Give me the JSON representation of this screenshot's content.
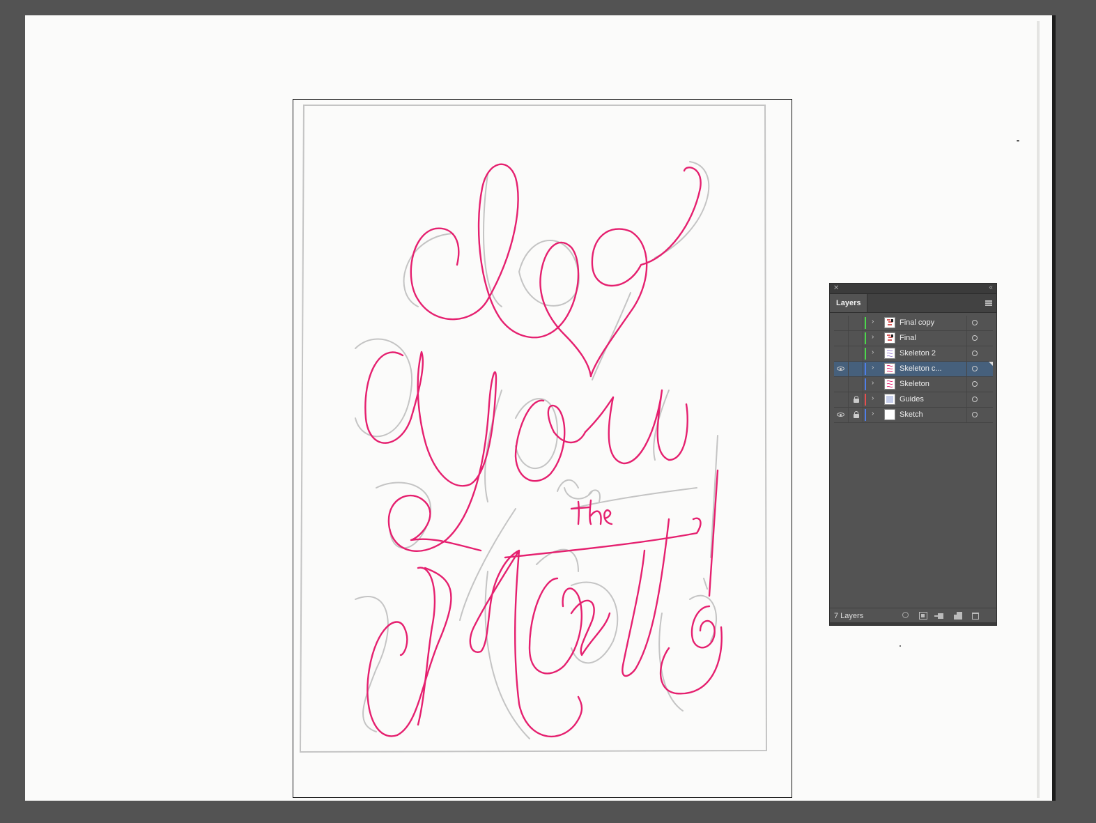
{
  "layers_panel": {
    "tab_title": "Layers",
    "layer_count_label": "7 Layers",
    "icons": {
      "close": "close-icon",
      "collapse": "collapse-icon",
      "menu": "panel-menu-icon",
      "visibility": "eye-icon",
      "lock": "lock-icon",
      "expand": "chevron-right-icon",
      "target": "target-circle-icon",
      "find": "find-icon",
      "clipping_mask": "clipping-mask-icon",
      "new_sublayer": "new-sublayer-icon",
      "new_layer": "new-layer-icon",
      "delete": "trash-icon"
    },
    "layers": [
      {
        "name": "Final copy",
        "color": "#4cd84c",
        "visible": false,
        "locked": false,
        "selected": false
      },
      {
        "name": "Final",
        "color": "#4cd84c",
        "visible": false,
        "locked": false,
        "selected": false
      },
      {
        "name": "Skeleton 2",
        "color": "#4cd84c",
        "visible": false,
        "locked": false,
        "selected": false
      },
      {
        "name": "Skeleton c...",
        "color": "#4f7ee8",
        "visible": true,
        "locked": false,
        "selected": true
      },
      {
        "name": "Skeleton",
        "color": "#4f7ee8",
        "visible": false,
        "locked": false,
        "selected": false
      },
      {
        "name": "Guides",
        "color": "#e84f4f",
        "visible": false,
        "locked": true,
        "selected": false
      },
      {
        "name": "Sketch",
        "color": "#4f7ee8",
        "visible": true,
        "locked": true,
        "selected": false
      }
    ]
  },
  "artwork": {
    "stroke_color": "#e5206f",
    "pencil_color": "#c2c2c2",
    "background": "#535353"
  }
}
